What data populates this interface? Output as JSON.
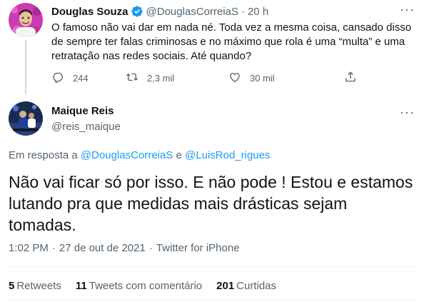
{
  "parent_tweet": {
    "name": "Douglas Souza",
    "handle": "@DouglasCorreiaS",
    "separator": "·",
    "time": "20 h",
    "text": "O famoso não vai dar em nada né. Toda vez a mesma coisa, cansado disso de sempre ter falas criminosas e no máximo que rola é uma “multa” e uma retratação nas redes sociais. Até quando?",
    "replies": "244",
    "retweets": "2,3 mil",
    "likes": "30 mil"
  },
  "main_tweet": {
    "name": "Maique Reis",
    "handle": "@reis_maique",
    "reply_prefix": "Em resposta a ",
    "reply_mention_1": "@DouglasCorreiaS",
    "reply_conj": " e ",
    "reply_mention_2": "@LuisRod_rigues",
    "text": "Não vai ficar só por isso. E não pode ! Estou e estamos lutando pra que medidas mais drásticas sejam tomadas.",
    "time": "1:02 PM",
    "dot": "·",
    "date": "27 de out de 2021",
    "source": "Twitter for iPhone",
    "stats": {
      "retweets_count": "5",
      "retweets_label": "Retweets",
      "quotes_count": "11",
      "quotes_label": "Tweets com comentário",
      "likes_count": "201",
      "likes_label": "Curtidas"
    }
  },
  "icons": {
    "verified": "verified-badge-icon",
    "more": "more-horizontal-icon",
    "reply": "reply-icon",
    "retweet": "retweet-icon",
    "like": "heart-icon",
    "share": "share-icon"
  },
  "colors": {
    "accent": "#1d9bf0",
    "text": "#0f1419",
    "secondary": "#536471",
    "thread_line": "#cfd9de"
  }
}
